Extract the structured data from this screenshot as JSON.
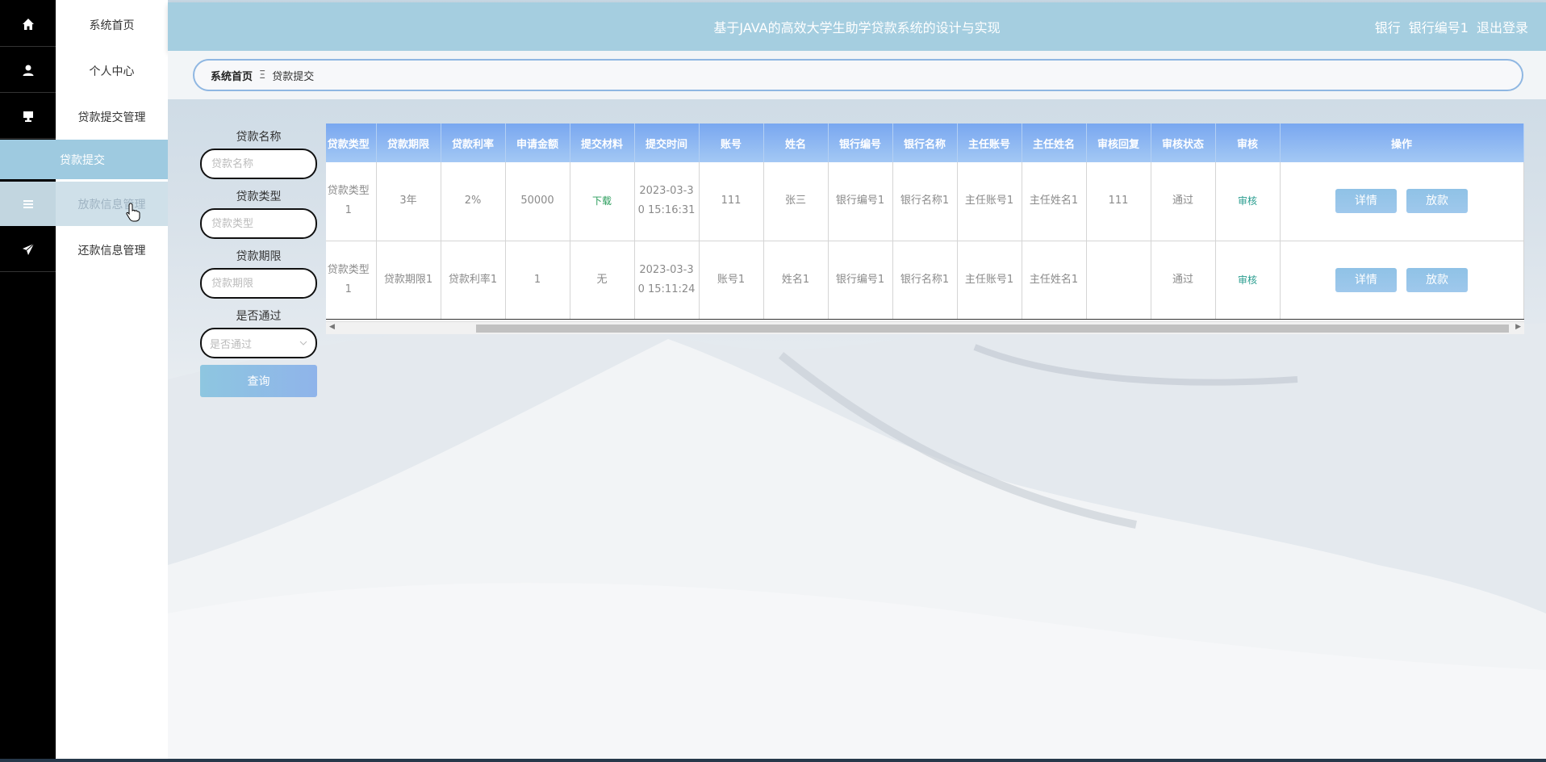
{
  "header": {
    "title": "基于JAVA的高效大学生助学贷款系统的设计与实现",
    "role": "银行",
    "user": "银行编号1",
    "logout": "退出登录"
  },
  "sidebar": {
    "items": [
      {
        "label": "系统首页",
        "icon": "home-icon"
      },
      {
        "label": "个人中心",
        "icon": "user-icon"
      },
      {
        "label": "贷款提交管理",
        "icon": "monitor-icon"
      },
      {
        "label": "放款信息管理",
        "icon": "menu-icon"
      },
      {
        "label": "还款信息管理",
        "icon": "send-icon"
      }
    ],
    "sub_item": "贷款提交"
  },
  "breadcrumb": {
    "home": "系统首页",
    "separator": "Ξ",
    "current": "贷款提交"
  },
  "search": {
    "loan_name_label": "贷款名称",
    "loan_name_placeholder": "贷款名称",
    "loan_type_label": "贷款类型",
    "loan_type_placeholder": "贷款类型",
    "loan_term_label": "贷款期限",
    "loan_term_placeholder": "贷款期限",
    "approved_label": "是否通过",
    "approved_placeholder": "是否通过",
    "query_button": "查询"
  },
  "table": {
    "columns": [
      "贷款类型",
      "贷款期限",
      "贷款利率",
      "申请金额",
      "提交材料",
      "提交时间",
      "账号",
      "姓名",
      "银行编号",
      "银行名称",
      "主任账号",
      "主任姓名",
      "审核回复",
      "审核状态",
      "审核",
      "操作"
    ],
    "rows": [
      {
        "loan_type": "贷款类型1",
        "term": "3年",
        "rate": "2%",
        "amount": "50000",
        "material": "下载",
        "time": "2023-03-30 15:16:31",
        "account": "111",
        "name": "张三",
        "bank_no": "银行编号1",
        "bank_name": "银行名称1",
        "director_account": "主任账号1",
        "director_name": "主任姓名1",
        "reply": "111",
        "status": "通过",
        "review": "审核",
        "detail_button": "详情",
        "disburse_button": "放款"
      },
      {
        "loan_type": "贷款类型1",
        "term": "贷款期限1",
        "rate": "贷款利率1",
        "amount": "1",
        "material": "无",
        "time": "2023-03-30 15:11:24",
        "account": "账号1",
        "name": "姓名1",
        "bank_no": "银行编号1",
        "bank_name": "银行名称1",
        "director_account": "主任账号1",
        "director_name": "主任姓名1",
        "reply": "",
        "status": "通过",
        "review": "审核",
        "detail_button": "详情",
        "disburse_button": "放款"
      }
    ]
  },
  "colors": {
    "header_bg": "#a5cee0",
    "sidebar_active": "#9ecae0",
    "table_header": "#79a7f0",
    "icon_rail": "#000000"
  }
}
